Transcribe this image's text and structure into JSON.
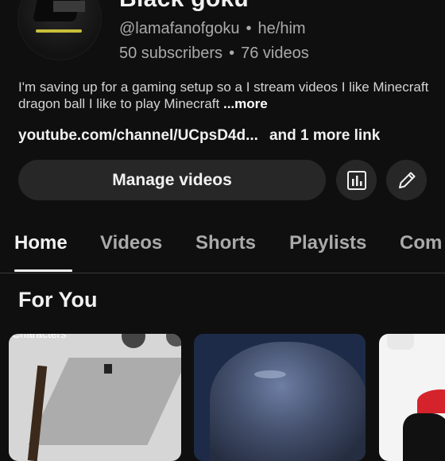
{
  "channel": {
    "name": "Black goku",
    "handle": "@lamafanofgoku",
    "pronouns": "he/him",
    "subscribers": "50 subscribers",
    "videos": "76 videos",
    "description": "I'm saving up for a gaming setup so a I stream videos I like Minecraft dragon ball I like to play Minecraft ",
    "more_label": "...more",
    "link_text": "youtube.com/channel/UCpsD4d...",
    "more_links": "and 1 more link"
  },
  "separator": "•",
  "actions": {
    "manage_label": "Manage videos",
    "analytics_icon": "analytics-icon",
    "edit_icon": "pencil-icon"
  },
  "tabs": [
    {
      "label": "Home",
      "active": true
    },
    {
      "label": "Videos",
      "active": false
    },
    {
      "label": "Shorts",
      "active": false
    },
    {
      "label": "Playlists",
      "active": false
    },
    {
      "label": "Com",
      "active": false
    }
  ],
  "section": {
    "title": "For You"
  },
  "thumbnails": [
    {
      "overlay_text": "Characters"
    }
  ],
  "colors": {
    "background": "#0f0f0f",
    "surface": "#272727",
    "text_primary": "#f1f1f1",
    "text_secondary": "#aaaaaa"
  }
}
